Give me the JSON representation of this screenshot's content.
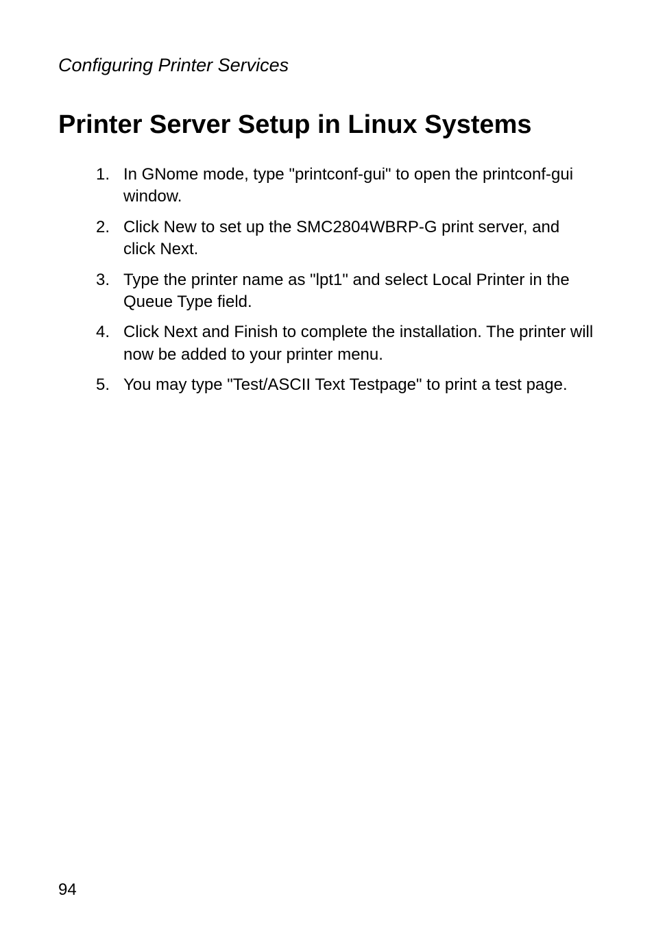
{
  "header": "Configuring Printer Services",
  "title": "Printer Server Setup in Linux Systems",
  "items": [
    {
      "number": "1.",
      "text": "In GNome mode, type \"printconf-gui\" to open the printconf-gui window."
    },
    {
      "number": "2.",
      "text": "Click New to set up the SMC2804WBRP-G print server, and click Next."
    },
    {
      "number": "3.",
      "text": "Type the printer name as \"lpt1\" and select Local Printer in the Queue Type field."
    },
    {
      "number": "4.",
      "text": "Click Next and Finish to complete the installation. The printer will now be added to your printer menu."
    },
    {
      "number": "5.",
      "text": "You may type \"Test/ASCII Text Testpage\" to print a test page."
    }
  ],
  "pageNumber": "94"
}
